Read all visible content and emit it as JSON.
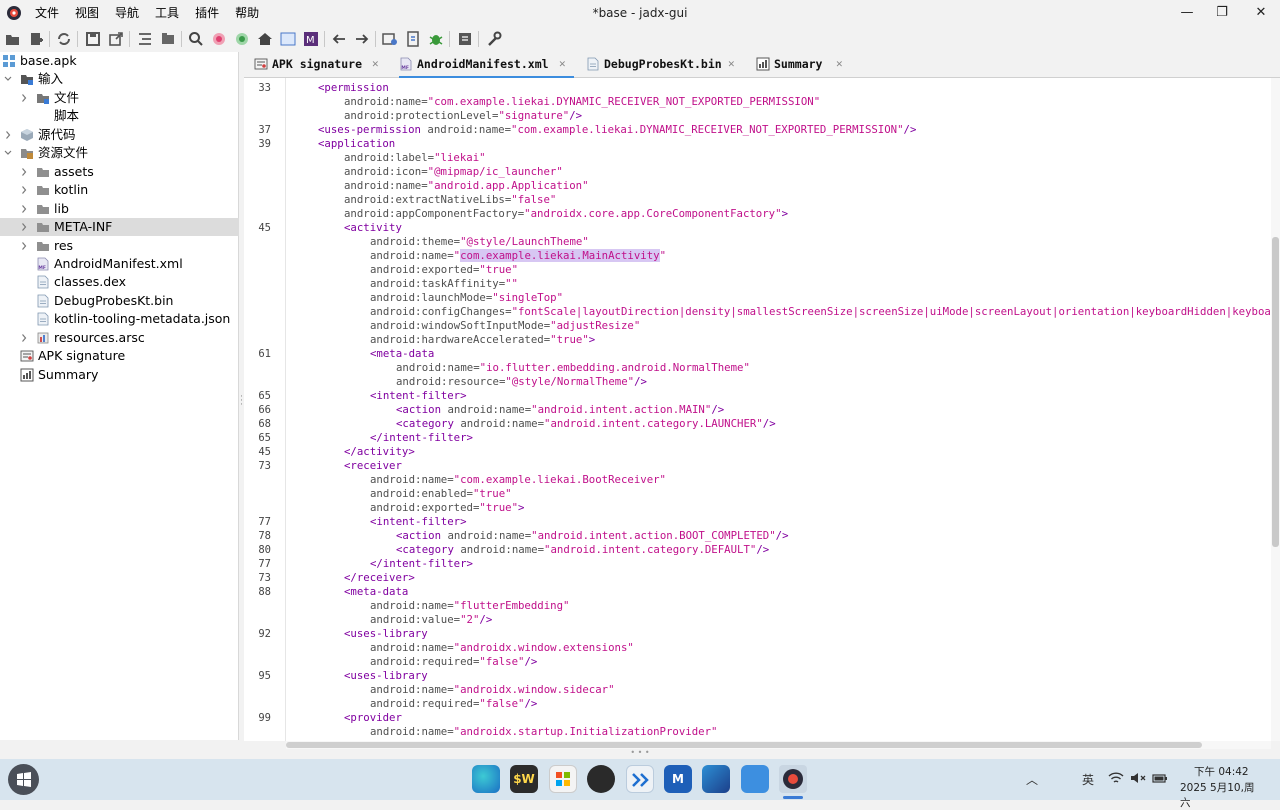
{
  "window": {
    "title": "*base - jadx-gui",
    "menu": [
      "文件",
      "视图",
      "导航",
      "工具",
      "插件",
      "帮助"
    ],
    "controls": {
      "minimize": "—",
      "restore": "❐",
      "close": "✕"
    }
  },
  "toolbar": {
    "icons": [
      "open-file-icon",
      "add-files-icon",
      "sync-icon",
      "save-icon",
      "export-icon",
      "flatten-icon",
      "package-icon",
      "search-icon",
      "find-usage-icon",
      "text-search-icon",
      "home-icon",
      "code-view-icon",
      "smali-icon",
      "back-icon",
      "forward-icon",
      "quark-icon",
      "deobf-icon",
      "debug-icon",
      "log-icon",
      "preferences-icon"
    ]
  },
  "sidebar": {
    "tree": [
      {
        "label": "base.apk",
        "indent": 0,
        "chevron": "",
        "icon": "apk-icon",
        "selected": false
      },
      {
        "label": "输入",
        "indent": 1,
        "chevron": "down",
        "icon": "input-folder-icon",
        "selected": false
      },
      {
        "label": "文件",
        "indent": 2,
        "chevron": "right",
        "icon": "file-folder-icon",
        "selected": false
      },
      {
        "label": "脚本",
        "indent": 2,
        "chevron": "",
        "icon": "none",
        "selected": false
      },
      {
        "label": "源代码",
        "indent": 1,
        "chevron": "right",
        "icon": "source-icon",
        "selected": false
      },
      {
        "label": "资源文件",
        "indent": 1,
        "chevron": "down",
        "icon": "resources-icon",
        "selected": false
      },
      {
        "label": "assets",
        "indent": 2,
        "chevron": "right",
        "icon": "folder-icon",
        "selected": false
      },
      {
        "label": "kotlin",
        "indent": 2,
        "chevron": "right",
        "icon": "folder-icon",
        "selected": false
      },
      {
        "label": "lib",
        "indent": 2,
        "chevron": "right",
        "icon": "folder-icon",
        "selected": false
      },
      {
        "label": "META-INF",
        "indent": 2,
        "chevron": "right",
        "icon": "folder-icon",
        "selected": true
      },
      {
        "label": "res",
        "indent": 2,
        "chevron": "right",
        "icon": "folder-icon",
        "selected": false
      },
      {
        "label": "AndroidManifest.xml",
        "indent": 2,
        "chevron": "",
        "icon": "manifest-icon",
        "selected": false
      },
      {
        "label": "classes.dex",
        "indent": 2,
        "chevron": "",
        "icon": "file-icon",
        "selected": false
      },
      {
        "label": "DebugProbesKt.bin",
        "indent": 2,
        "chevron": "",
        "icon": "file-icon",
        "selected": false
      },
      {
        "label": "kotlin-tooling-metadata.json",
        "indent": 2,
        "chevron": "",
        "icon": "file-icon",
        "selected": false
      },
      {
        "label": "resources.arsc",
        "indent": 2,
        "chevron": "right",
        "icon": "arsc-icon",
        "selected": false
      },
      {
        "label": "APK signature",
        "indent": 1,
        "chevron": "",
        "icon": "certificate-icon",
        "selected": false
      },
      {
        "label": "Summary",
        "indent": 1,
        "chevron": "",
        "icon": "summary-icon",
        "selected": false
      }
    ]
  },
  "tabs": [
    {
      "label": "APK signature",
      "icon": "certificate-icon",
      "active": false
    },
    {
      "label": "AndroidManifest.xml",
      "icon": "manifest-icon",
      "active": true
    },
    {
      "label": "DebugProbesKt.bin",
      "icon": "file-icon",
      "active": false
    },
    {
      "label": "Summary",
      "icon": "summary-icon",
      "active": false
    }
  ],
  "tab_close_glyph": "✕",
  "editor": {
    "lines": [
      {
        "n": "33",
        "i": 1,
        "t": [
          [
            "tg",
            "<permission"
          ]
        ]
      },
      {
        "n": "",
        "i": 2,
        "t": [
          [
            "an",
            "android:name="
          ],
          [
            "av",
            "\"com.example.liekai.DYNAMIC_RECEIVER_NOT_EXPORTED_PERMISSION\""
          ]
        ]
      },
      {
        "n": "",
        "i": 2,
        "t": [
          [
            "an",
            "android:protectionLevel="
          ],
          [
            "av",
            "\"signature\""
          ],
          [
            "tg",
            "/>"
          ]
        ]
      },
      {
        "n": "37",
        "i": 1,
        "t": [
          [
            "tg",
            "<uses-permission "
          ],
          [
            "an",
            "android:name="
          ],
          [
            "av",
            "\"com.example.liekai.DYNAMIC_RECEIVER_NOT_EXPORTED_PERMISSION\""
          ],
          [
            "tg",
            "/>"
          ]
        ]
      },
      {
        "n": "39",
        "i": 1,
        "t": [
          [
            "tg",
            "<application"
          ]
        ]
      },
      {
        "n": "",
        "i": 2,
        "t": [
          [
            "an",
            "android:label="
          ],
          [
            "av",
            "\"liekai\""
          ]
        ]
      },
      {
        "n": "",
        "i": 2,
        "t": [
          [
            "an",
            "android:icon="
          ],
          [
            "av",
            "\"@mipmap/ic_launcher\""
          ]
        ]
      },
      {
        "n": "",
        "i": 2,
        "t": [
          [
            "an",
            "android:name="
          ],
          [
            "av",
            "\"android.app.Application\""
          ]
        ]
      },
      {
        "n": "",
        "i": 2,
        "t": [
          [
            "an",
            "android:extractNativeLibs="
          ],
          [
            "av",
            "\"false\""
          ]
        ]
      },
      {
        "n": "",
        "i": 2,
        "t": [
          [
            "an",
            "android:appComponentFactory="
          ],
          [
            "av",
            "\"androidx.core.app.CoreComponentFactory\""
          ],
          [
            "tg",
            ">"
          ]
        ]
      },
      {
        "n": "45",
        "i": 2,
        "t": [
          [
            "tg",
            "<activity"
          ]
        ]
      },
      {
        "n": "",
        "i": 3,
        "t": [
          [
            "an",
            "android:theme="
          ],
          [
            "av",
            "\"@style/LaunchTheme\""
          ]
        ]
      },
      {
        "n": "",
        "i": 3,
        "t": [
          [
            "an",
            "android:name="
          ],
          [
            "av",
            "\""
          ],
          [
            "caret",
            ""
          ],
          [
            "hl",
            "com.example.liekai.MainActivity"
          ],
          [
            "av",
            "\""
          ]
        ]
      },
      {
        "n": "",
        "i": 3,
        "t": [
          [
            "an",
            "android:exported="
          ],
          [
            "av",
            "\"true\""
          ]
        ]
      },
      {
        "n": "",
        "i": 3,
        "t": [
          [
            "an",
            "android:taskAffinity="
          ],
          [
            "av",
            "\"\""
          ]
        ]
      },
      {
        "n": "",
        "i": 3,
        "t": [
          [
            "an",
            "android:launchMode="
          ],
          [
            "av",
            "\"singleTop\""
          ]
        ]
      },
      {
        "n": "",
        "i": 3,
        "t": [
          [
            "an",
            "android:configChanges="
          ],
          [
            "av",
            "\"fontScale|layoutDirection|density|smallestScreenSize|screenSize|uiMode|screenLayout|orientation|keyboardHidden|keyboard|locale\""
          ]
        ]
      },
      {
        "n": "",
        "i": 3,
        "t": [
          [
            "an",
            "android:windowSoftInputMode="
          ],
          [
            "av",
            "\"adjustResize\""
          ]
        ]
      },
      {
        "n": "",
        "i": 3,
        "t": [
          [
            "an",
            "android:hardwareAccelerated="
          ],
          [
            "av",
            "\"true\""
          ],
          [
            "tg",
            ">"
          ]
        ]
      },
      {
        "n": "61",
        "i": 3,
        "t": [
          [
            "tg",
            "<meta-data"
          ]
        ]
      },
      {
        "n": "",
        "i": 4,
        "t": [
          [
            "an",
            "android:name="
          ],
          [
            "av",
            "\"io.flutter.embedding.android.NormalTheme\""
          ]
        ]
      },
      {
        "n": "",
        "i": 4,
        "t": [
          [
            "an",
            "android:resource="
          ],
          [
            "av",
            "\"@style/NormalTheme\""
          ],
          [
            "tg",
            "/>"
          ]
        ]
      },
      {
        "n": "65",
        "i": 3,
        "t": [
          [
            "tg",
            "<intent-filter>"
          ]
        ]
      },
      {
        "n": "66",
        "i": 4,
        "t": [
          [
            "tg",
            "<action "
          ],
          [
            "an",
            "android:name="
          ],
          [
            "av",
            "\"android.intent.action.MAIN\""
          ],
          [
            "tg",
            "/>"
          ]
        ]
      },
      {
        "n": "68",
        "i": 4,
        "t": [
          [
            "tg",
            "<category "
          ],
          [
            "an",
            "android:name="
          ],
          [
            "av",
            "\"android.intent.category.LAUNCHER\""
          ],
          [
            "tg",
            "/>"
          ]
        ]
      },
      {
        "n": "65",
        "i": 3,
        "t": [
          [
            "tg",
            "</intent-filter>"
          ]
        ]
      },
      {
        "n": "45",
        "i": 2,
        "t": [
          [
            "tg",
            "</activity>"
          ]
        ]
      },
      {
        "n": "73",
        "i": 2,
        "t": [
          [
            "tg",
            "<receiver"
          ]
        ]
      },
      {
        "n": "",
        "i": 3,
        "t": [
          [
            "an",
            "android:name="
          ],
          [
            "av",
            "\"com.example.liekai.BootReceiver\""
          ]
        ]
      },
      {
        "n": "",
        "i": 3,
        "t": [
          [
            "an",
            "android:enabled="
          ],
          [
            "av",
            "\"true\""
          ]
        ]
      },
      {
        "n": "",
        "i": 3,
        "t": [
          [
            "an",
            "android:exported="
          ],
          [
            "av",
            "\"true\""
          ],
          [
            "tg",
            ">"
          ]
        ]
      },
      {
        "n": "77",
        "i": 3,
        "t": [
          [
            "tg",
            "<intent-filter>"
          ]
        ]
      },
      {
        "n": "78",
        "i": 4,
        "t": [
          [
            "tg",
            "<action "
          ],
          [
            "an",
            "android:name="
          ],
          [
            "av",
            "\"android.intent.action.BOOT_COMPLETED\""
          ],
          [
            "tg",
            "/>"
          ]
        ]
      },
      {
        "n": "80",
        "i": 4,
        "t": [
          [
            "tg",
            "<category "
          ],
          [
            "an",
            "android:name="
          ],
          [
            "av",
            "\"android.intent.category.DEFAULT\""
          ],
          [
            "tg",
            "/>"
          ]
        ]
      },
      {
        "n": "77",
        "i": 3,
        "t": [
          [
            "tg",
            "</intent-filter>"
          ]
        ]
      },
      {
        "n": "73",
        "i": 2,
        "t": [
          [
            "tg",
            "</receiver>"
          ]
        ]
      },
      {
        "n": "88",
        "i": 2,
        "t": [
          [
            "tg",
            "<meta-data"
          ]
        ]
      },
      {
        "n": "",
        "i": 3,
        "t": [
          [
            "an",
            "android:name="
          ],
          [
            "av",
            "\"flutterEmbedding\""
          ]
        ]
      },
      {
        "n": "",
        "i": 3,
        "t": [
          [
            "an",
            "android:value="
          ],
          [
            "av",
            "\"2\""
          ],
          [
            "tg",
            "/>"
          ]
        ]
      },
      {
        "n": "92",
        "i": 2,
        "t": [
          [
            "tg",
            "<uses-library"
          ]
        ]
      },
      {
        "n": "",
        "i": 3,
        "t": [
          [
            "an",
            "android:name="
          ],
          [
            "av",
            "\"androidx.window.extensions\""
          ]
        ]
      },
      {
        "n": "",
        "i": 3,
        "t": [
          [
            "an",
            "android:required="
          ],
          [
            "av",
            "\"false\""
          ],
          [
            "tg",
            "/>"
          ]
        ]
      },
      {
        "n": "95",
        "i": 2,
        "t": [
          [
            "tg",
            "<uses-library"
          ]
        ]
      },
      {
        "n": "",
        "i": 3,
        "t": [
          [
            "an",
            "android:name="
          ],
          [
            "av",
            "\"androidx.window.sidecar\""
          ]
        ]
      },
      {
        "n": "",
        "i": 3,
        "t": [
          [
            "an",
            "android:required="
          ],
          [
            "av",
            "\"false\""
          ],
          [
            "tg",
            "/>"
          ]
        ]
      },
      {
        "n": "99",
        "i": 2,
        "t": [
          [
            "tg",
            "<provider"
          ]
        ]
      },
      {
        "n": "",
        "i": 3,
        "t": [
          [
            "an",
            "android:name="
          ],
          [
            "av",
            "\"androidx.startup.InitializationProvider\""
          ]
        ]
      }
    ],
    "vertical_scroll_position": 0.24,
    "horizontal_scroll_visible_fraction": 0.93
  },
  "taskbar": {
    "apps": [
      "edge-icon",
      "wps-icon",
      "store-icon",
      "obs-icon",
      "vscode-like-icon",
      "word-icon",
      "editor-icon",
      "file-explorer-icon",
      "jadx-icon"
    ],
    "tray": [
      "chevron-up-icon",
      "ime-icon",
      "wifi-icon",
      "volume-muted-icon",
      "battery-icon"
    ],
    "ime_label": "英",
    "time": "下午 04:42",
    "date": "2025 5月10,周六"
  },
  "colors": {
    "tag": "#8000a0",
    "attr_name": "#505050",
    "attr_value": "#c0108a",
    "selection": "#d7c7f3",
    "tab_accent": "#3c8dde"
  }
}
